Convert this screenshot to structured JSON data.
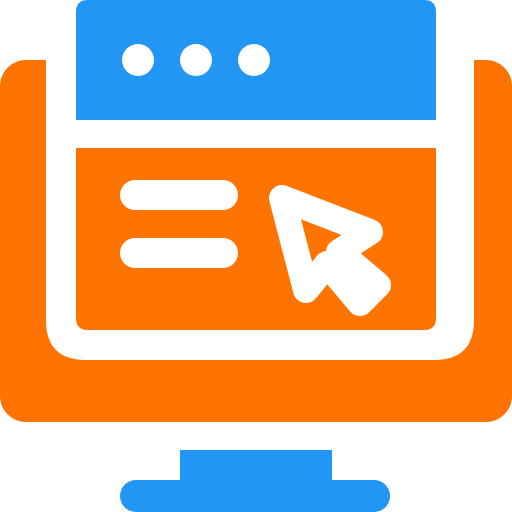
{
  "icon": {
    "name": "web-browser-click-icon",
    "colors": {
      "orange": "#FF7300",
      "blue": "#2196F3",
      "white": "#FFFFFF"
    }
  }
}
